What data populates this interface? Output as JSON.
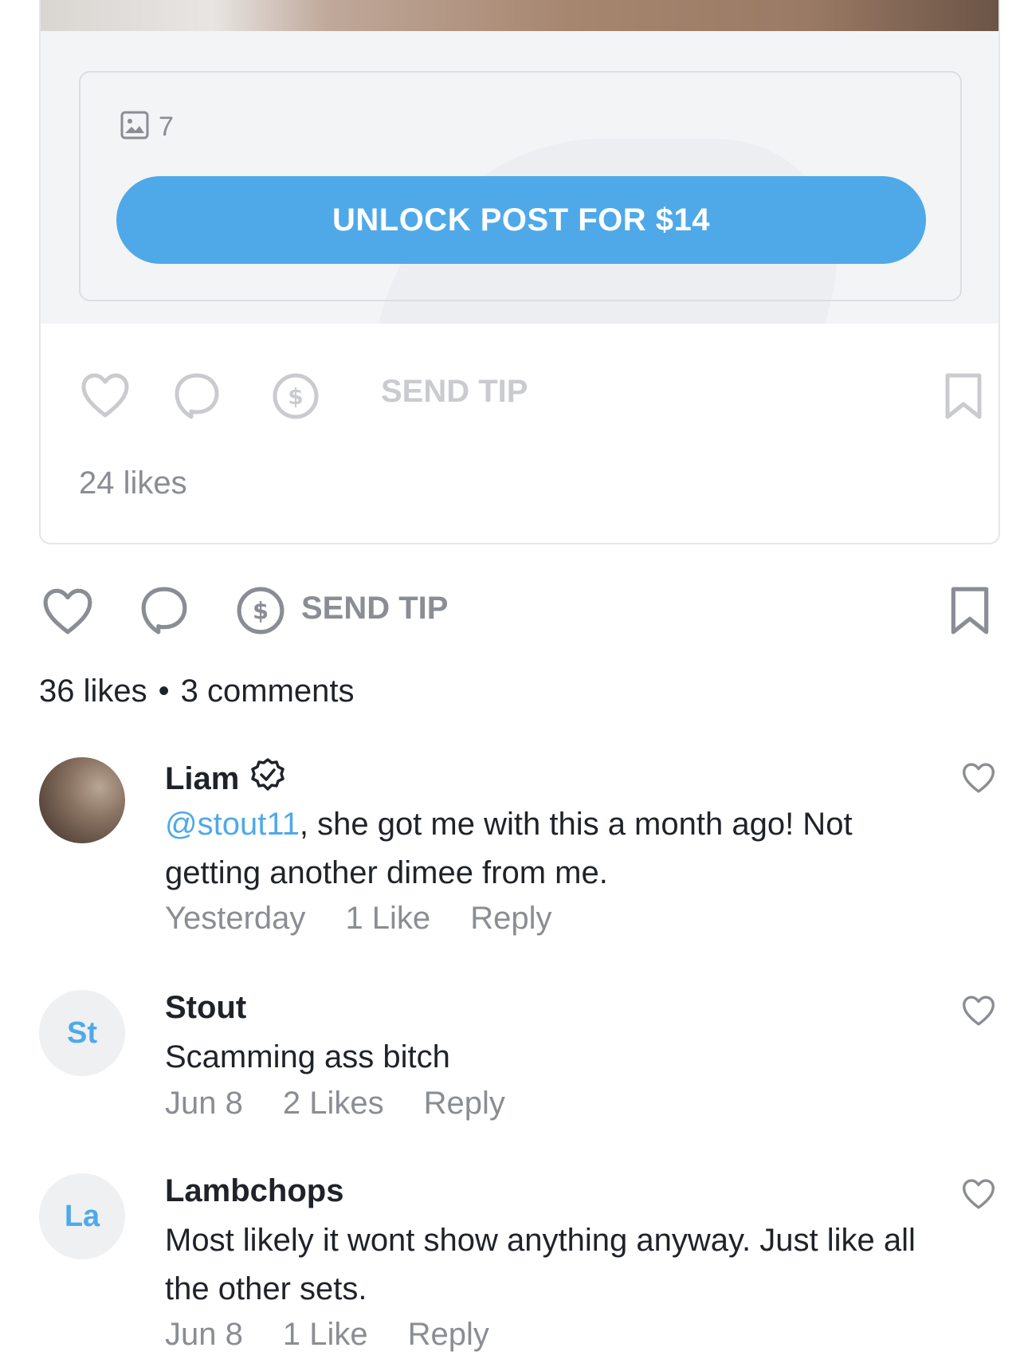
{
  "locked_post": {
    "media_count": "7",
    "unlock_label": "UNLOCK POST FOR $14",
    "send_tip_label": "SEND TIP",
    "likes_text": "24 likes"
  },
  "post_actions": {
    "send_tip_label": "SEND TIP",
    "likes_text": "36 likes",
    "separator": "•",
    "comments_text": "3 comments"
  },
  "comments": [
    {
      "avatar_initials": "",
      "author": "Liam",
      "verified": true,
      "mention": "@stout11",
      "text": ", she got me with this a month ago! Not getting another dimee from me.",
      "time": "Yesterday",
      "likes": "1 Like",
      "reply": "Reply"
    },
    {
      "avatar_initials": "St",
      "author": "Stout",
      "text": "Scamming ass bitch",
      "time": "Jun 8",
      "likes": "2 Likes",
      "reply": "Reply"
    },
    {
      "avatar_initials": "La",
      "author": "Lambchops",
      "text": "Most likely it wont show anything anyway. Just like all the other sets.",
      "time": "Jun 8",
      "likes": "1 Like",
      "reply": "Reply"
    }
  ],
  "colors": {
    "accent": "#4fa9e8",
    "text": "#1f2329",
    "muted": "#8a8d93",
    "icon": "#8a8d93"
  },
  "icons": [
    "image-icon",
    "heart-icon",
    "comment-icon",
    "dollar-icon",
    "bookmark-icon",
    "verified-badge-icon"
  ]
}
